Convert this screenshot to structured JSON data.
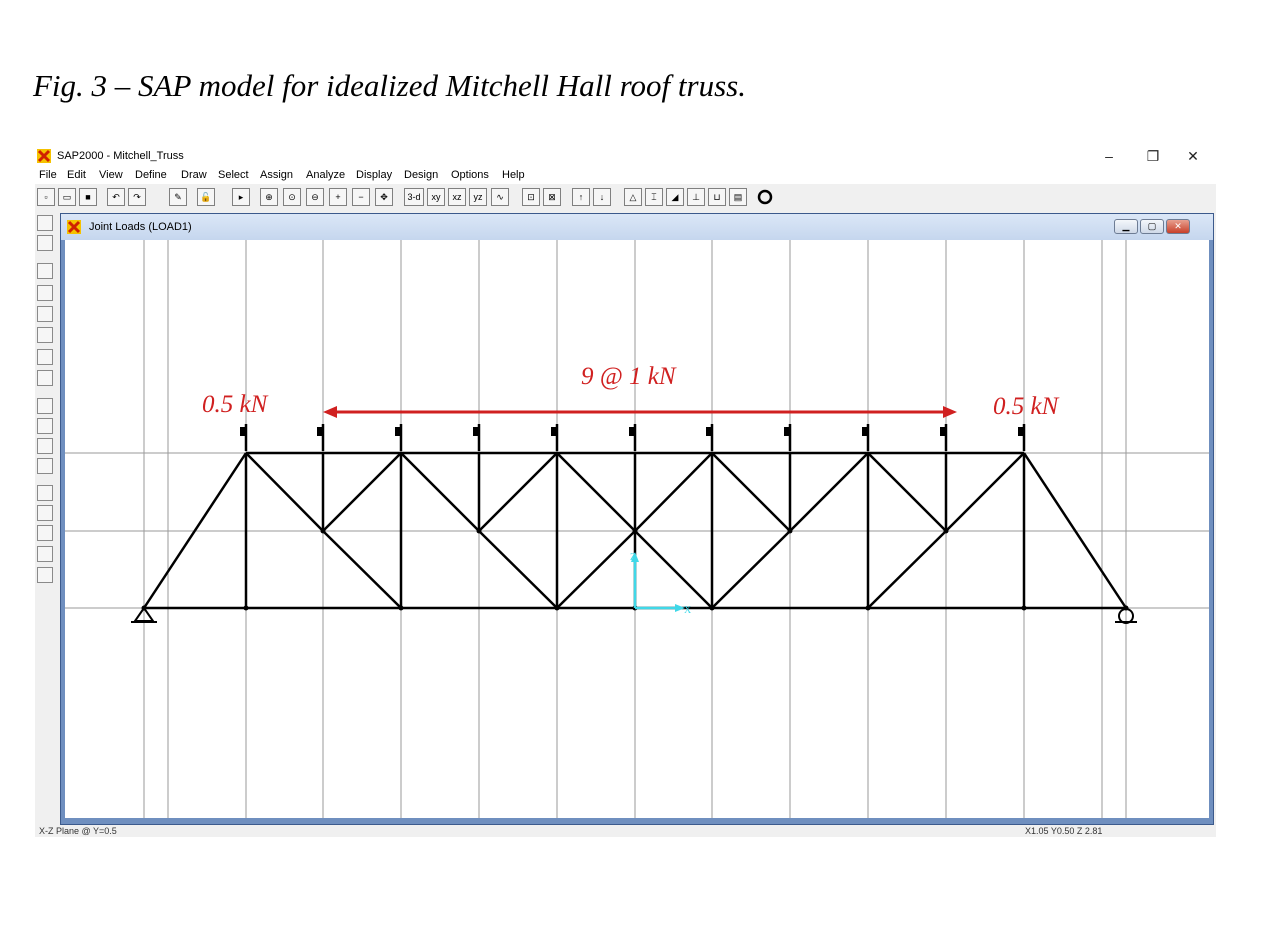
{
  "caption": "Fig. 3 – SAP model for idealized Mitchell Hall roof truss.",
  "app": {
    "title": "SAP2000 - Mitchell_Truss",
    "window_controls": [
      "–",
      "❐",
      "✕"
    ]
  },
  "menu": [
    "File",
    "Edit",
    "View",
    "Define",
    "Draw",
    "Select",
    "Assign",
    "Analyze",
    "Display",
    "Design",
    "Options",
    "Help"
  ],
  "toolbar": {
    "view_buttons": [
      "3-d",
      "xy",
      "xz",
      "yz"
    ]
  },
  "model_window": {
    "title": "Joint Loads (LOAD1)"
  },
  "annotations": {
    "left_end_load": "0.5 kN",
    "right_end_load": "0.5 kN",
    "interior_loads": "9 @ 1 kN"
  },
  "axes": {
    "x": "X",
    "z": "Z"
  },
  "status": {
    "left": "X-Z Plane @ Y=0.5",
    "right": "X1.05  Y0.50  Z 2.81"
  },
  "colors": {
    "annotation": "#d02020",
    "axes": "#40d8e8",
    "truss": "#000000",
    "window_frame": "#6f8fbf"
  }
}
